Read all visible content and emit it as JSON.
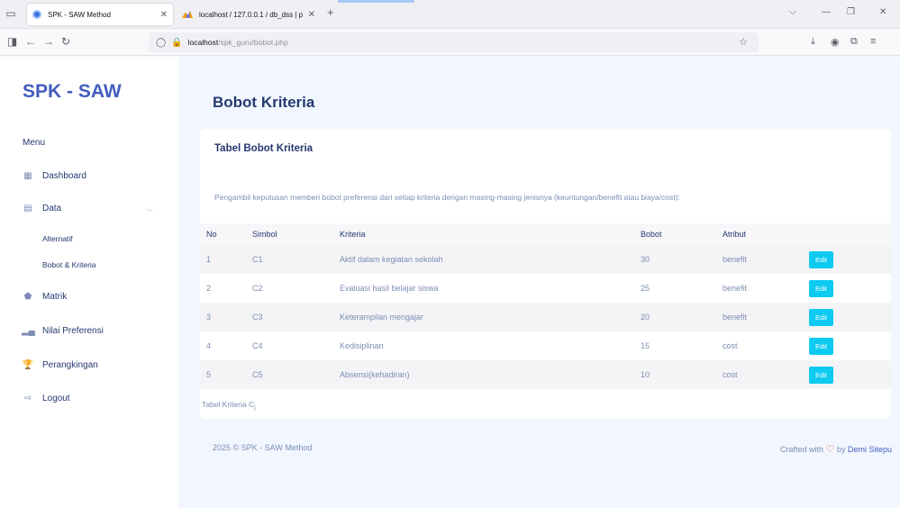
{
  "browser": {
    "tabs": [
      {
        "title": "SPK - SAW Method",
        "active": true
      },
      {
        "title": "localhost / 127.0.0.1 / db_dss | p",
        "active": false
      }
    ],
    "url_host": "localhost",
    "url_path": "/spk_guru/bobot.php"
  },
  "sidebar": {
    "logo": "SPK - SAW",
    "menu_title": "Menu",
    "items": [
      {
        "label": "Dashboard",
        "icon": "grid-icon"
      },
      {
        "label": "Data",
        "icon": "stack-icon"
      },
      {
        "label": "Matrik",
        "icon": "pentagon-icon"
      },
      {
        "label": "Nilai Preferensi",
        "icon": "bar-chart-icon"
      },
      {
        "label": "Perangkingan",
        "icon": "trophy-icon"
      },
      {
        "label": "Logout",
        "icon": "logout-icon"
      }
    ],
    "sub_items": [
      {
        "label": "Alternatif"
      },
      {
        "label": "Bobot & Kriteria"
      }
    ]
  },
  "main": {
    "page_heading": "Bobot Kriteria",
    "card_title": "Tabel Bobot Kriteria",
    "description": "Pengambil keputusan memberi bobot preferensi dari setiap kriteria dengan masing-masing jenisnya (keuntungan/benefit atau biaya/cost):",
    "table": {
      "headers": [
        "No",
        "Simbol",
        "Kriteria",
        "Bobot",
        "Atribut"
      ],
      "rows": [
        [
          "1",
          "C1",
          "Aktif dalam kegiatan sekolah",
          "30",
          "benefit"
        ],
        [
          "2",
          "C2",
          "Evaluasi hasil belajar siswa",
          "25",
          "benefit"
        ],
        [
          "3",
          "C3",
          "Keterampilan mengajar",
          "20",
          "benefit"
        ],
        [
          "4",
          "C4",
          "Kedisiplinan",
          "15",
          "cost"
        ],
        [
          "5",
          "C5",
          "Absensi(kehadiran)",
          "10",
          "cost"
        ]
      ],
      "edit_label": "Edit",
      "caption": "Tabel Kriteria C",
      "caption_sub": "j"
    }
  },
  "footer": {
    "left": "2025 © SPK - SAW Method",
    "right_prefix": "Crafted with",
    "right_by": "by",
    "right_author": "Demi Sitepu"
  },
  "colors": {
    "accent": "#435ebe",
    "edit_button": "#0dcaf0",
    "background": "#f2f7ff"
  }
}
